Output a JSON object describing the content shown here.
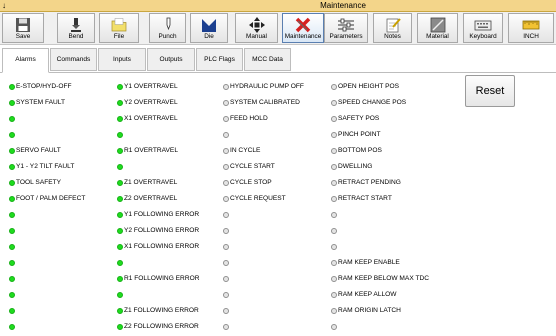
{
  "window": {
    "title": "Maintenance",
    "system_glyph": "↓"
  },
  "toolbar": [
    {
      "label": "Save",
      "icon": "floppy-disk-icon"
    },
    {
      "label": "Bend",
      "icon": "bend-icon"
    },
    {
      "label": "File",
      "icon": "folder-icon"
    },
    {
      "label": "Punch",
      "icon": "punch-icon"
    },
    {
      "label": "Die",
      "icon": "die-icon"
    },
    {
      "label": "Manual",
      "icon": "move-arrows-icon"
    },
    {
      "label": "Maintenance",
      "icon": "tools-icon",
      "active": true
    },
    {
      "label": "Parameters",
      "icon": "parameters-icon"
    },
    {
      "label": "Notes",
      "icon": "notes-icon"
    },
    {
      "label": "Material",
      "icon": "material-icon"
    },
    {
      "label": "Keyboard",
      "icon": "keyboard-icon"
    },
    {
      "label": "INCH",
      "icon": "ruler-icon"
    }
  ],
  "tabs": [
    {
      "label": "Alarms",
      "active": true
    },
    {
      "label": "Commands"
    },
    {
      "label": "Inputs"
    },
    {
      "label": "Outputs"
    },
    {
      "label": "PLC Flags"
    },
    {
      "label": "MCC Data"
    }
  ],
  "reset_label": "Reset",
  "columns": [
    [
      {
        "label": "E-STOP/HYD-OFF",
        "on": true
      },
      {
        "label": "SYSTEM FAULT",
        "on": true
      },
      {
        "label": "",
        "on": true
      },
      {
        "label": "",
        "on": true
      },
      {
        "label": "SERVO FAULT",
        "on": true
      },
      {
        "label": "Y1 - Y2 TILT FAULT",
        "on": true
      },
      {
        "label": "TOOL SAFETY",
        "on": true
      },
      {
        "label": "FOOT / PALM DEFECT",
        "on": true
      },
      {
        "label": "",
        "on": true
      },
      {
        "label": "",
        "on": true
      },
      {
        "label": "",
        "on": true
      },
      {
        "label": "",
        "on": true
      },
      {
        "label": "",
        "on": true
      },
      {
        "label": "",
        "on": true
      },
      {
        "label": "",
        "on": true
      },
      {
        "label": "",
        "on": true
      }
    ],
    [
      {
        "label": "Y1 OVERTRAVEL",
        "on": true
      },
      {
        "label": "Y2 OVERTRAVEL",
        "on": true
      },
      {
        "label": "X1 OVERTRAVEL",
        "on": true
      },
      {
        "label": "",
        "on": true
      },
      {
        "label": "R1 OVERTRAVEL",
        "on": true
      },
      {
        "label": "",
        "on": true
      },
      {
        "label": "Z1 OVERTRAVEL",
        "on": true
      },
      {
        "label": "Z2 OVERTRAVEL",
        "on": true
      },
      {
        "label": "Y1 FOLLOWING ERROR",
        "on": true
      },
      {
        "label": "Y2 FOLLOWING ERROR",
        "on": true
      },
      {
        "label": "X1 FOLLOWING ERROR",
        "on": true
      },
      {
        "label": "",
        "on": true
      },
      {
        "label": "R1 FOLLOWING ERROR",
        "on": true
      },
      {
        "label": "",
        "on": true
      },
      {
        "label": "Z1 FOLLOWING ERROR",
        "on": true
      },
      {
        "label": "Z2 FOLLOWING ERROR",
        "on": true
      }
    ],
    [
      {
        "label": "HYDRAULIC PUMP OFF",
        "on": false
      },
      {
        "label": "SYSTEM CALIBRATED",
        "on": false
      },
      {
        "label": "FEED HOLD",
        "on": false
      },
      {
        "label": "",
        "on": false
      },
      {
        "label": "IN CYCLE",
        "on": false
      },
      {
        "label": "CYCLE START",
        "on": false
      },
      {
        "label": "CYCLE STOP",
        "on": false
      },
      {
        "label": "CYCLE REQUEST",
        "on": false
      },
      {
        "label": "",
        "on": false
      },
      {
        "label": "",
        "on": false
      },
      {
        "label": "",
        "on": false
      },
      {
        "label": "",
        "on": false
      },
      {
        "label": "",
        "on": false
      },
      {
        "label": "",
        "on": false
      },
      {
        "label": "",
        "on": false
      },
      {
        "label": "",
        "on": false
      }
    ],
    [
      {
        "label": "OPEN HEIGHT POS",
        "on": false
      },
      {
        "label": "SPEED CHANGE POS",
        "on": false
      },
      {
        "label": "SAFETY POS",
        "on": false
      },
      {
        "label": "PINCH POINT",
        "on": false
      },
      {
        "label": "BOTTOM POS",
        "on": false
      },
      {
        "label": "DWELLING",
        "on": false
      },
      {
        "label": "RETRACT PENDING",
        "on": false
      },
      {
        "label": "RETRACT START",
        "on": false
      },
      {
        "label": "",
        "on": false
      },
      {
        "label": "",
        "on": false
      },
      {
        "label": "",
        "on": false
      },
      {
        "label": "RAM KEEP ENABLE",
        "on": false
      },
      {
        "label": "RAM KEEP BELOW MAX TDC",
        "on": false
      },
      {
        "label": "RAM KEEP ALLOW",
        "on": false
      },
      {
        "label": "RAM ORIGIN LATCH",
        "on": false
      },
      {
        "label": "",
        "on": false
      }
    ]
  ]
}
